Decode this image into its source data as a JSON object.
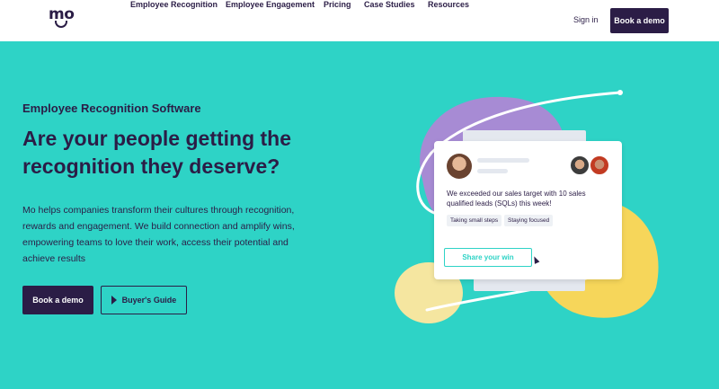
{
  "brand": {
    "logo_text": "mo"
  },
  "nav": {
    "items": [
      "Employee Recognition",
      "Employee Engagement",
      "Pricing",
      "Case Studies",
      "Resources"
    ],
    "sign_in": "Sign in",
    "cta": "Book a demo"
  },
  "hero": {
    "eyebrow": "Employee Recognition Software",
    "headline": "Are your people getting the recognition they deserve?",
    "description": "Mo helps companies transform their cultures through recognition, rewards and engagement. We build connection and amplify wins, empowering teams to love their work, access their potential and achieve results",
    "primary_cta": "Book a demo",
    "secondary_cta": "Buyer's Guide"
  },
  "illustration": {
    "message": "We exceeded our sales target with 10 sales qualified leads (SQLs) this week!",
    "tags": [
      "Taking small steps",
      "Staying focused"
    ],
    "share_button": "Share your win"
  },
  "colors": {
    "background": "#2ED3C6",
    "navy": "#2B1D46",
    "purple_blob": "#A78BD4",
    "yellow_blob": "#F6D65A",
    "light_yellow_blob": "#F5E6A0"
  }
}
